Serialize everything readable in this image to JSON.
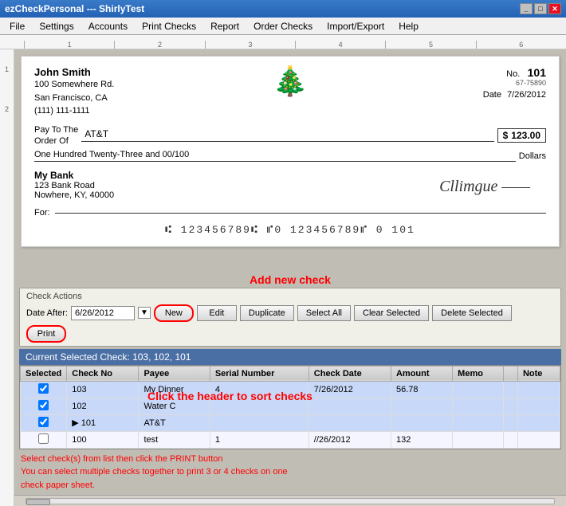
{
  "titleBar": {
    "title": "ezCheckPersonal --- ShirlyTest",
    "buttons": [
      "minimize",
      "maximize",
      "close"
    ]
  },
  "menuBar": {
    "items": [
      "File",
      "Settings",
      "Accounts",
      "Print Checks",
      "Report",
      "Order Checks",
      "Import/Export",
      "Help"
    ]
  },
  "ruler": {
    "marks": [
      "1",
      "2",
      "3",
      "4",
      "5",
      "6"
    ]
  },
  "check": {
    "name": "John Smith",
    "address1": "100 Somewhere Rd.",
    "address2": "San Francisco, CA",
    "phone": "(111) 111-1111",
    "noLabel": "No.",
    "checkNumber": "101",
    "routing": "67-75890",
    "dateLabel": "Date",
    "date": "7/26/2012",
    "payToLabel": "Pay To The",
    "orderOfLabel": "Order Of",
    "payee": "AT&T",
    "dollarSign": "$",
    "amount": "123.00",
    "amountWords": "One Hundred Twenty-Three and 00/100",
    "dollarsLabel": "Dollars",
    "bankName": "My Bank",
    "bankAddress1": "123 Bank Road",
    "bankAddress2": "Nowhere, KY, 40000",
    "forLabel": "For:",
    "micrLine": "⑆ 123456789⑆  ⑈0 123456789⑈  0 101",
    "signature": "Cllimgue"
  },
  "addCheckAnnotation": "Add new check",
  "checkActions": {
    "title": "Check Actions",
    "dateAfterLabel": "Date After:",
    "dateValue": "6/26/2012",
    "buttons": {
      "new": "New",
      "edit": "Edit",
      "duplicate": "Duplicate",
      "selectAll": "Select All",
      "clearSelected": "Clear Selected",
      "deleteSelected": "Delete Selected",
      "print": "Print"
    }
  },
  "currentSelected": {
    "label": "Current Selected Check: 103, 102, 101"
  },
  "tableHeaders": [
    "Selected",
    "Check No",
    "Payee",
    "Serial Number",
    "Check Date",
    "Amount",
    "Memo",
    "",
    "Note"
  ],
  "tableRows": [
    {
      "selected": true,
      "checkNo": "103",
      "payee": "My Dinner",
      "serial": "4",
      "date": "7/26/2012",
      "amount": "56.78",
      "memo": "",
      "note": ""
    },
    {
      "selected": true,
      "checkNo": "102",
      "payee": "Water C",
      "serial": "",
      "date": "",
      "amount": "",
      "memo": "",
      "note": ""
    },
    {
      "selected": true,
      "checkNo": "101",
      "payee": "AT&T",
      "serial": "",
      "date": "",
      "amount": "",
      "memo": "",
      "note": ""
    },
    {
      "selected": false,
      "checkNo": "100",
      "payee": "test",
      "serial": "1",
      "date": "//26/2012",
      "amount": "132",
      "memo": "",
      "note": ""
    }
  ],
  "sortAnnotation": "Click the header to sort checks",
  "bottomAnnotation": {
    "line1": "Select check(s) from list then click the PRINT button",
    "line2": "You can select multiple checks together to print 3 or 4 checks on one",
    "line3": "check paper sheet."
  }
}
